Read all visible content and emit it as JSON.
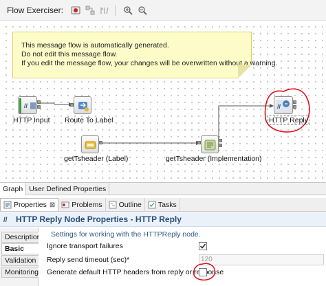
{
  "toolbar": {
    "label": "Flow Exerciser:",
    "icons": [
      "record-icon",
      "flow-icon",
      "step-icon",
      "zoom-in-icon",
      "zoom-out-icon"
    ]
  },
  "editor_tabs": [
    "Graph",
    "User Defined Properties"
  ],
  "note": {
    "lines": [
      "This message flow is automatically generated.",
      "Do not edit this message flow.",
      "If you edit the message flow, your changes will be overwritten without a warning."
    ]
  },
  "nodes": {
    "http_input": "HTTP Input",
    "route_to_label": "Route To Label",
    "http_reply": "HTTP Reply",
    "gettsheader_label": "getTsheader (Label)",
    "gettsheader_impl": "getTsheader (Implementation)"
  },
  "view_tabs": [
    {
      "label": "Properties",
      "close": "⊠"
    },
    {
      "label": "Problems"
    },
    {
      "label": "Outline"
    },
    {
      "label": "Tasks"
    }
  ],
  "properties": {
    "title": "HTTP Reply Node Properties - HTTP Reply",
    "description": "Settings for working with the HTTPReply node.",
    "sections": [
      "Description",
      "Basic",
      "Validation",
      "Monitoring"
    ],
    "active_section": "Basic",
    "fields": {
      "ignore_transport_failures": {
        "label": "Ignore transport failures",
        "checked": true
      },
      "reply_send_timeout": {
        "label": "Reply send timeout (sec)*",
        "value": "120"
      },
      "generate_default_headers": {
        "label": "Generate default HTTP headers from reply or response",
        "checked": false
      }
    }
  },
  "colors": {
    "annotation": "#e0101a",
    "header_text": "#2a4d7a",
    "note_bg": "#fdfbc8"
  }
}
